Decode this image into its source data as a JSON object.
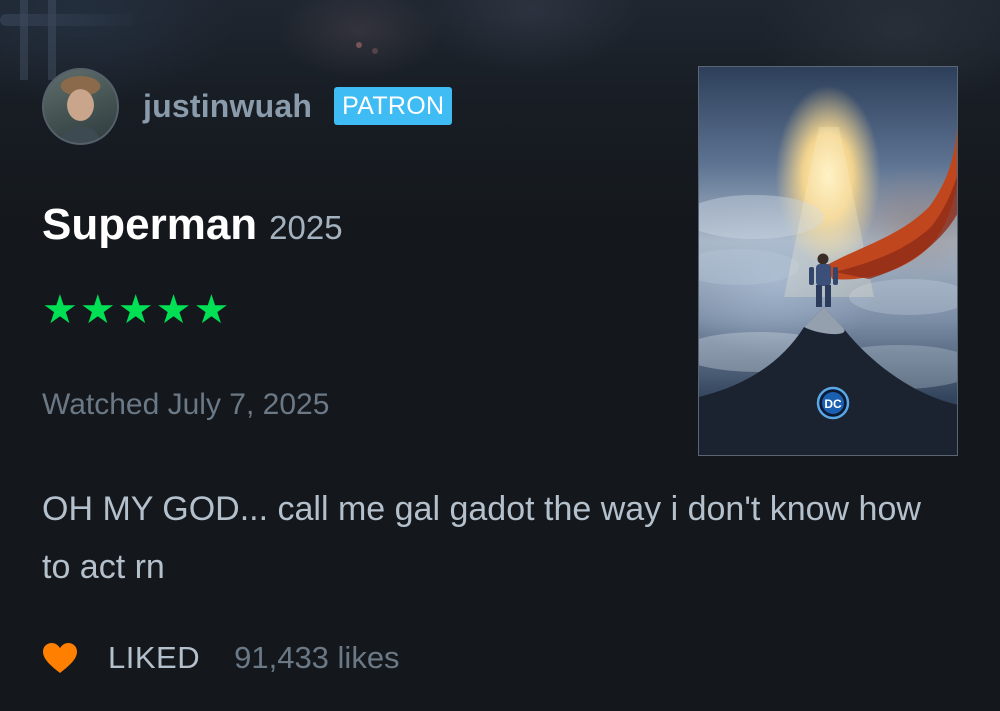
{
  "user": {
    "username": "justinwuah",
    "badge": "PATRON"
  },
  "film": {
    "title": "Superman",
    "year": "2025",
    "rating_stars": 5,
    "poster_logo": "DC"
  },
  "review": {
    "watched": "Watched July 7, 2025",
    "text": "OH MY GOD... call me gal gadot the way i don't know how to act rn"
  },
  "likes": {
    "liked_label": "LIKED",
    "count_text": "91,433 likes"
  },
  "colors": {
    "star": "#00e054",
    "heart": "#ff8000",
    "badge": "#40bcf4",
    "background": "#14181c"
  },
  "icons": {
    "star": "star-icon",
    "heart": "heart-icon"
  }
}
